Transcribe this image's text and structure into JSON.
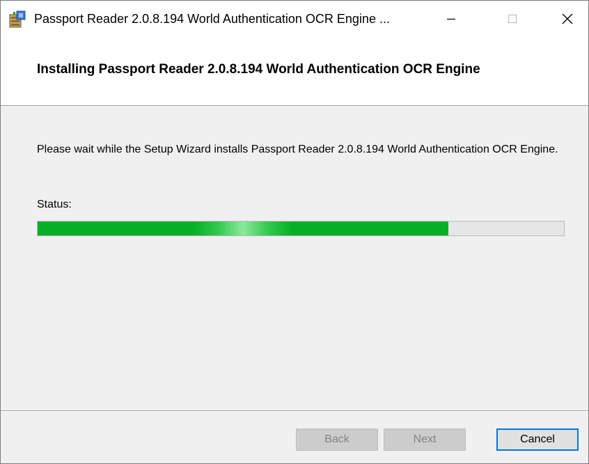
{
  "window": {
    "title": "Passport Reader 2.0.8.194 World Authentication OCR Engine ...",
    "icon": "installer-package-icon",
    "controls": {
      "minimize_icon": "minimize-icon",
      "maximize_icon": "maximize-icon",
      "close_icon": "close-icon"
    }
  },
  "header": {
    "title": "Installing Passport Reader 2.0.8.194 World Authentication OCR Engine"
  },
  "main": {
    "description": "Please wait while the Setup Wizard installs Passport Reader 2.0.8.194 World Authentication OCR Engine.",
    "status_label": "Status:",
    "progress_fraction": 0.78
  },
  "buttons": {
    "back": "Back",
    "next": "Next",
    "cancel": "Cancel"
  },
  "colors": {
    "progress_fill": "#06b025",
    "progress_track": "#e6e6e6",
    "focus_border": "#0078d7"
  }
}
